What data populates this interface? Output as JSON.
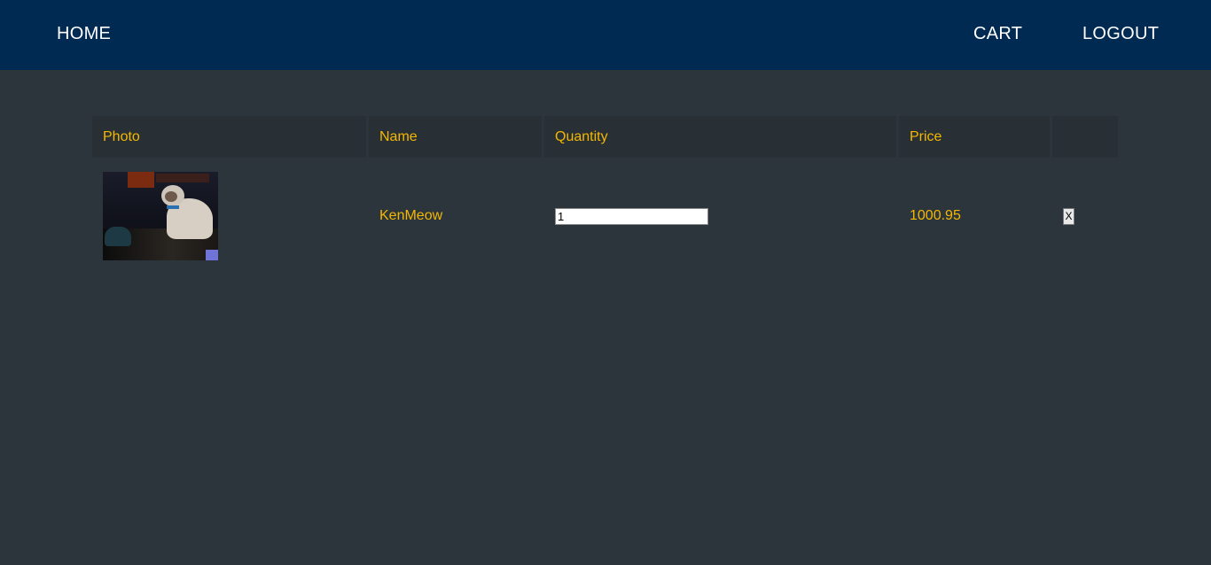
{
  "nav": {
    "home_label": "HOME",
    "cart_label": "CART",
    "logout_label": "LOGOUT"
  },
  "cart": {
    "headers": {
      "photo": "Photo",
      "name": "Name",
      "quantity": "Quantity",
      "price": "Price",
      "action": ""
    },
    "items": [
      {
        "photo_icon": "cat-photo",
        "name": "KenMeow",
        "quantity": "1",
        "price": "1000.95",
        "remove_label": "X"
      }
    ]
  },
  "colors": {
    "navbar_bg": "#002a52",
    "page_bg": "#2c353c",
    "header_bg": "#283036",
    "accent_text": "#f5b800"
  }
}
